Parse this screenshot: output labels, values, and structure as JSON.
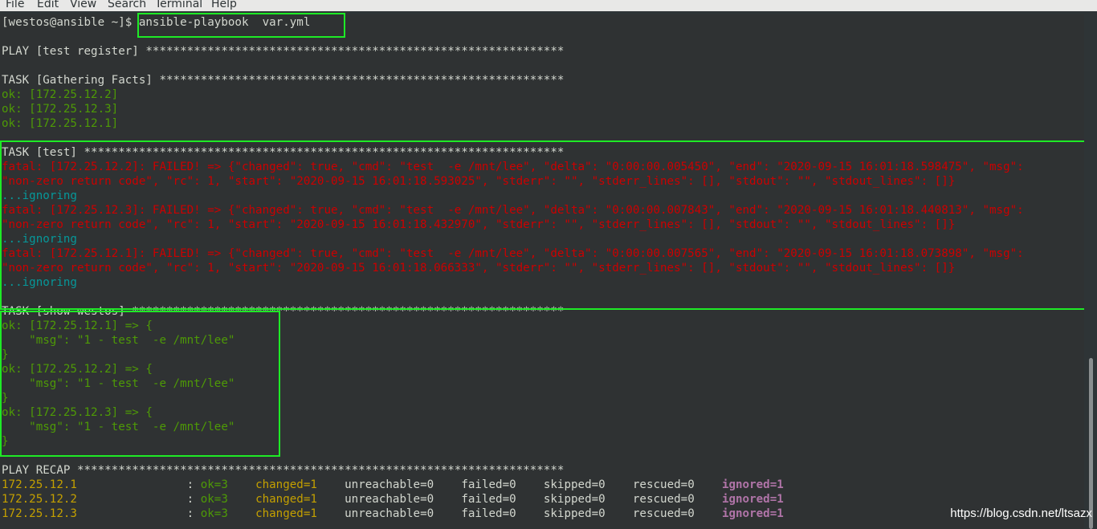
{
  "menu": [
    "File",
    "Edit",
    "View",
    "Search",
    "Terminal",
    "Help"
  ],
  "prompt": "[westos@ansible ~]$ ",
  "command": "ansible-playbook  var.yml",
  "play_header": "PLAY [test register] *************************************************************",
  "task_gather": "TASK [Gathering Facts] ***********************************************************",
  "gather_ok": [
    "ok: [172.25.12.2]",
    "ok: [172.25.12.3]",
    "ok: [172.25.12.1]"
  ],
  "task_test": "TASK [test] **********************************************************************",
  "fatal": [
    {
      "line1": "fatal: [172.25.12.2]: FAILED! => {\"changed\": true, \"cmd\": \"test  -e /mnt/lee\", \"delta\": \"0:00:00.005450\", \"end\": \"2020-09-15 16:01:18.598475\", \"msg\":",
      "line2": "\"non-zero return code\", \"rc\": 1, \"start\": \"2020-09-15 16:01:18.593025\", \"stderr\": \"\", \"stderr_lines\": [], \"stdout\": \"\", \"stdout_lines\": []}",
      "ignoring": "...ignoring"
    },
    {
      "line1": "fatal: [172.25.12.3]: FAILED! => {\"changed\": true, \"cmd\": \"test  -e /mnt/lee\", \"delta\": \"0:00:00.007843\", \"end\": \"2020-09-15 16:01:18.440813\", \"msg\":",
      "line2": "\"non-zero return code\", \"rc\": 1, \"start\": \"2020-09-15 16:01:18.432970\", \"stderr\": \"\", \"stderr_lines\": [], \"stdout\": \"\", \"stdout_lines\": []}",
      "ignoring": "...ignoring"
    },
    {
      "line1": "fatal: [172.25.12.1]: FAILED! => {\"changed\": true, \"cmd\": \"test  -e /mnt/lee\", \"delta\": \"0:00:00.007565\", \"end\": \"2020-09-15 16:01:18.073898\", \"msg\":",
      "line2": "\"non-zero return code\", \"rc\": 1, \"start\": \"2020-09-15 16:01:18.066333\", \"stderr\": \"\", \"stderr_lines\": [], \"stdout\": \"\", \"stdout_lines\": []}",
      "ignoring": "...ignoring"
    }
  ],
  "task_show": "TASK [show westos] ***************************************************************",
  "show": [
    {
      "head": "ok: [172.25.12.1] => {",
      "msg": "    \"msg\": \"1 - test  -e /mnt/lee\"",
      "close": "}"
    },
    {
      "head": "ok: [172.25.12.2] => {",
      "msg": "    \"msg\": \"1 - test  -e /mnt/lee\"",
      "close": "}"
    },
    {
      "head": "ok: [172.25.12.3] => {",
      "msg": "    \"msg\": \"1 - test  -e /mnt/lee\"",
      "close": "}"
    }
  ],
  "recap_header": "PLAY RECAP ***********************************************************************",
  "recap": [
    {
      "host": "172.25.12.1                ",
      "sep": ": ",
      "ok": "ok=3",
      "changed": "changed=1",
      "unreachable": "unreachable=0",
      "failed": "failed=0",
      "skipped": "skipped=0",
      "rescued": "rescued=0",
      "ignored": "ignored=1"
    },
    {
      "host": "172.25.12.2                ",
      "sep": ": ",
      "ok": "ok=3",
      "changed": "changed=1",
      "unreachable": "unreachable=0",
      "failed": "failed=0",
      "skipped": "skipped=0",
      "rescued": "rescued=0",
      "ignored": "ignored=1"
    },
    {
      "host": "172.25.12.3                ",
      "sep": ": ",
      "ok": "ok=3",
      "changed": "changed=1",
      "unreachable": "unreachable=0",
      "failed": "failed=0",
      "skipped": "skipped=0",
      "rescued": "rescued=0",
      "ignored": "ignored=1"
    }
  ],
  "watermark": "https://blog.csdn.net/ltsazx",
  "colors": {
    "ok": "#4e9a06",
    "fatal": "#cc0000",
    "ignoring": "#06989a",
    "changed": "#c4a000",
    "ignored": "#b074a8",
    "highlight": "#1eea26"
  }
}
